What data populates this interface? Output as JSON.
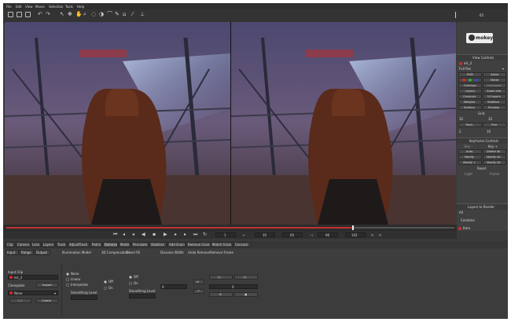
{
  "menu": [
    "File",
    "Edit",
    "View",
    "Movie",
    "Selection",
    "Tools",
    "Help"
  ],
  "panel": {
    "frame_number": "65",
    "logo_text": "mokey",
    "view_controls": {
      "header": "View Controls",
      "clip": "elc_2",
      "zoom": "Full Res",
      "buttons": [
        "RGB",
        "Alpha",
        "",
        "Matte",
        "Overlays",
        "Overlayed",
        "Layers",
        "Zoom Info",
        "Contours",
        "UI Layers",
        "Weights",
        "Stabilize",
        "Surface",
        "Preview"
      ],
      "grid_label": "Grid",
      "grid_x": "32",
      "grid_y": "32",
      "track": "Track",
      "fine": "Fine",
      "val_a": "2",
      "val_b": "10"
    },
    "keyframe": {
      "header": "Keyframe Controls",
      "key_minus": "Key -",
      "key_plus": "Key +",
      "buttons": [
        "Auto",
        "Delete All",
        "Modify",
        "Modify All",
        "Modify +",
        "Modify All"
      ],
      "reset": "Reset",
      "sub": [
        "Light",
        "Frame"
      ]
    },
    "layers_render": "Layers to Render",
    "all_label": "All",
    "combine": "Combine",
    "frame_end": "Item"
  },
  "transport": {
    "fields": [
      "1",
      "35",
      "65",
      "96",
      "102"
    ]
  },
  "tabs_row1": [
    "Clip",
    "Camera",
    "Lens",
    "Layers",
    "Track",
    "AdjustTrack",
    "Patch",
    "Remove",
    "Matte",
    "Percolate",
    "Stabilize",
    "Add Grain",
    "Remove Grain",
    "Match Grain",
    "Conceal"
  ],
  "active_tab": 7,
  "tabs_row2": [
    "Input",
    "Range",
    "Output"
  ],
  "toolbar2": [
    "Illumination Model",
    "3D Compensation",
    "Panel Fill",
    "Dissolve Width",
    "Undo Remove",
    "Remove Frame"
  ],
  "bottom": {
    "input_clip_label": "Input Clip",
    "input_clip": "elc_2",
    "clean_plate_label": "Cleanplate",
    "import_label": "Import",
    "none_label": "None",
    "cut_label": "Cut",
    "create_label": "Create",
    "options1": [
      "None",
      "Linear",
      "Interpolate"
    ],
    "smoothing_label": "Smoothing Level",
    "options2": [
      "Off",
      "On"
    ],
    "options3": [
      "Off",
      "On"
    ],
    "smoothing_label2": "Smoothing Level",
    "field_value": "0",
    "field_value2": "0"
  },
  "colors": {
    "red": "#d22a2a",
    "green": "#2faa2f",
    "blue": "#2a4ad2",
    "timeline_played": "#c83030"
  }
}
